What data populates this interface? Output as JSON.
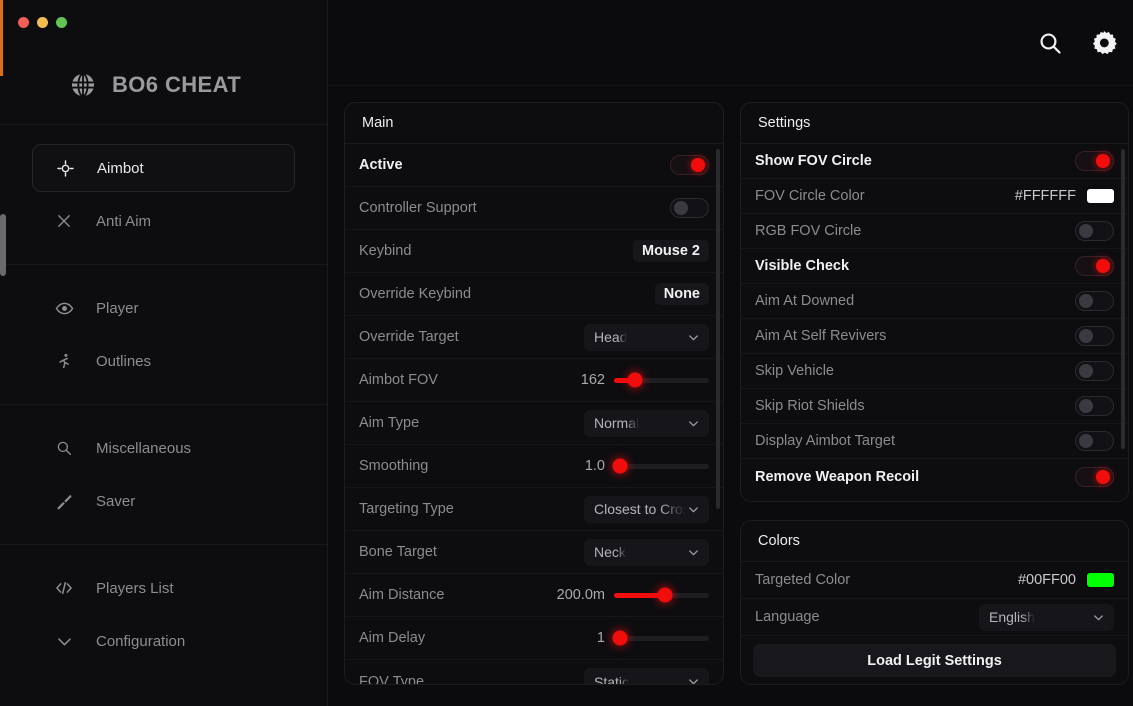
{
  "window": {
    "traffic_lights": [
      "close",
      "minimize",
      "zoom"
    ]
  },
  "brand": {
    "title": "BO6 CHEAT",
    "icon": "globe-icon"
  },
  "topbar": {
    "search_icon": "search-icon",
    "settings_icon": "gear-icon"
  },
  "sidebar": {
    "groups": [
      {
        "items": [
          {
            "label": "Aimbot",
            "icon": "crosshair-icon",
            "active": true
          },
          {
            "label": "Anti Aim",
            "icon": "close-x-icon",
            "active": false
          }
        ]
      },
      {
        "items": [
          {
            "label": "Player",
            "icon": "eye-icon",
            "active": false
          },
          {
            "label": "Outlines",
            "icon": "running-person-icon",
            "active": false
          }
        ]
      },
      {
        "items": [
          {
            "label": "Miscellaneous",
            "icon": "search-icon",
            "active": false
          },
          {
            "label": "Saver",
            "icon": "knife-icon",
            "active": false
          }
        ]
      },
      {
        "items": [
          {
            "label": "Players List",
            "icon": "code-icon",
            "active": false
          },
          {
            "label": "Configuration",
            "icon": "chevron-down-icon",
            "active": false
          }
        ]
      }
    ]
  },
  "panels": {
    "main": {
      "title": "Main",
      "rows": [
        {
          "label": "Active",
          "type": "toggle",
          "value": true
        },
        {
          "label": "Controller Support",
          "type": "toggle",
          "value": false
        },
        {
          "label": "Keybind",
          "type": "chip",
          "value": "Mouse 2"
        },
        {
          "label": "Override Keybind",
          "type": "chip",
          "value": "None"
        },
        {
          "label": "Override Target",
          "type": "select",
          "value": "Head"
        },
        {
          "label": "Aimbot FOV",
          "type": "slider",
          "value": "162",
          "percent": 22
        },
        {
          "label": "Aim Type",
          "type": "select",
          "value": "Normal"
        },
        {
          "label": "Smoothing",
          "type": "slider",
          "value": "1.0",
          "percent": 8
        },
        {
          "label": "Targeting Type",
          "type": "select",
          "value": "Closest to Crosshair"
        },
        {
          "label": "Bone Target",
          "type": "select",
          "value": "Neck"
        },
        {
          "label": "Aim Distance",
          "type": "slider",
          "value": "200.0m",
          "percent": 54
        },
        {
          "label": "Aim Delay",
          "type": "slider",
          "value": "1",
          "percent": 8
        },
        {
          "label": "FOV Type",
          "type": "select",
          "value": "Static"
        }
      ]
    },
    "settings": {
      "title": "Settings",
      "rows": [
        {
          "label": "Show FOV Circle",
          "type": "toggle",
          "value": true
        },
        {
          "label": "FOV Circle Color",
          "type": "color",
          "value": "#FFFFFF"
        },
        {
          "label": "RGB FOV Circle",
          "type": "toggle",
          "value": false
        },
        {
          "label": "Visible Check",
          "type": "toggle",
          "value": true
        },
        {
          "label": "Aim At Downed",
          "type": "toggle",
          "value": false
        },
        {
          "label": "Aim At Self Revivers",
          "type": "toggle",
          "value": false
        },
        {
          "label": "Skip Vehicle",
          "type": "toggle",
          "value": false
        },
        {
          "label": "Skip Riot Shields",
          "type": "toggle",
          "value": false
        },
        {
          "label": "Display Aimbot Target",
          "type": "toggle",
          "value": false
        },
        {
          "label": "Remove Weapon Recoil",
          "type": "toggle",
          "value": true
        }
      ]
    },
    "colors": {
      "title": "Colors",
      "rows": [
        {
          "label": "Targeted Color",
          "type": "color",
          "value": "#00FF00"
        },
        {
          "label": "Language",
          "type": "select",
          "value": "English"
        }
      ],
      "button": "Load Legit Settings"
    }
  },
  "theme": {
    "accent_red": "#F20D0D",
    "accent_orange": "#D4741A",
    "background": "#0B0B0D",
    "panel": "#0D0D10"
  }
}
